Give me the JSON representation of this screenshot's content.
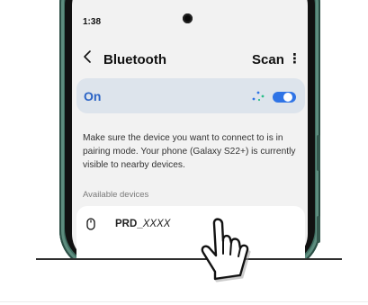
{
  "status": {
    "time": "1:38"
  },
  "header": {
    "title": "Bluetooth",
    "scan_label": "Scan",
    "more_label": "⋮"
  },
  "bluetooth": {
    "state_label": "On",
    "enabled": true
  },
  "description": "Make sure the device you want to connect to is in pairing mode. Your phone (Galaxy S22+) is currently visible to nearby devices.",
  "available": {
    "section_label": "Available devices",
    "devices": [
      {
        "name_prefix": "PRD_",
        "name_suffix": "XXXX",
        "icon": "mouse-icon"
      }
    ]
  },
  "colors": {
    "accent": "#2f74e6",
    "on_text": "#2a63c5",
    "phone_frame": "#3e6d60",
    "card_bg": "#dde4ec"
  },
  "icons": [
    "camera-icon",
    "back-arrow-icon",
    "more-vert-icon",
    "scanning-dots-icon",
    "toggle-switch",
    "mouse-icon",
    "pointing-hand-icon"
  ]
}
